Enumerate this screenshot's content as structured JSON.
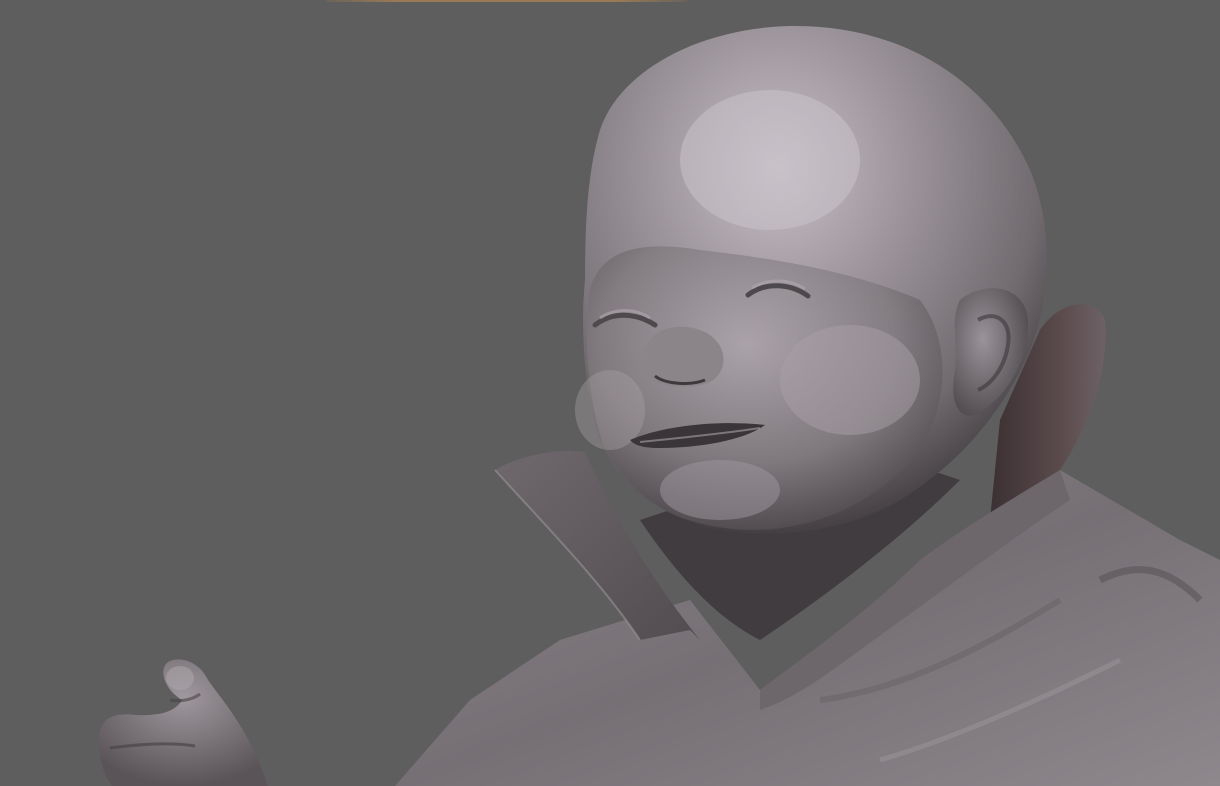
{
  "viewport": {
    "background_color": "#5e5e5e",
    "accent_color": "#9a7a55",
    "clay_light": "#bdb6bc",
    "clay_mid": "#8d878d",
    "clay_dark": "#3c383b"
  },
  "model": {
    "icon": "baby-bust-sculpt",
    "material": "matcap-grey-clay"
  }
}
